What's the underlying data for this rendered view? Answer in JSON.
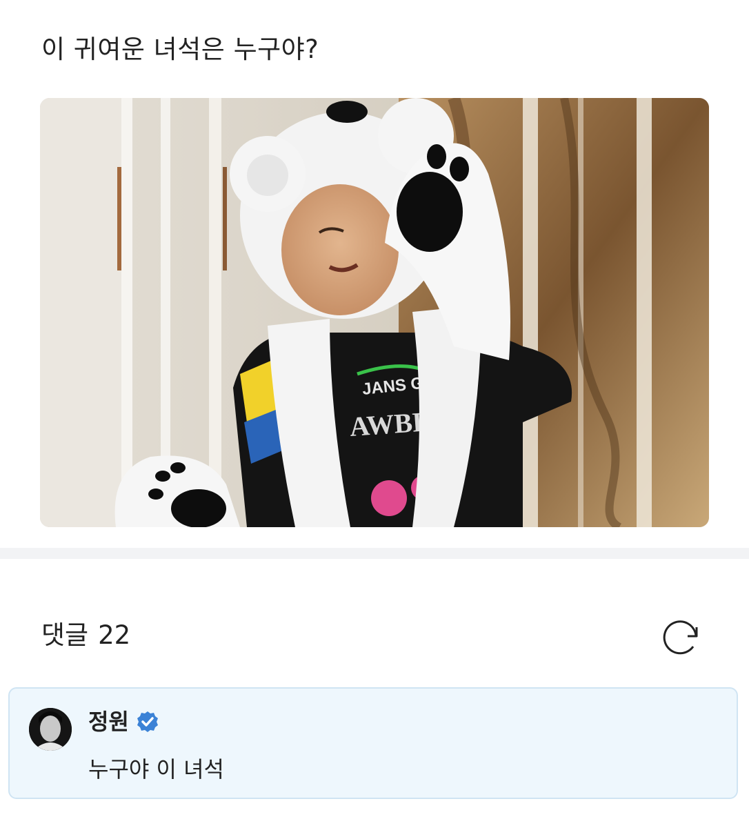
{
  "post": {
    "text": "이 귀여운 녀석은 누구야?",
    "photo": {
      "alt": "Child wearing a white polar bear hat with paws, eyes closed",
      "shirt_text_top": "JANS GRET",
      "shirt_text_main": "AWBE"
    }
  },
  "comments": {
    "label": "댓글",
    "count": "22",
    "refresh_icon": "refresh-icon",
    "items": [
      {
        "author": "정원",
        "verified": true,
        "verified_icon": "verified-badge-icon",
        "text": "누구야 이 녀석"
      }
    ]
  },
  "colors": {
    "background": "#ffffff",
    "divider": "#f2f3f5",
    "comment_card_bg": "#eef7fd",
    "comment_card_border": "#cfe4f3",
    "verified_blue": "#3b82d6",
    "text": "#222222"
  }
}
